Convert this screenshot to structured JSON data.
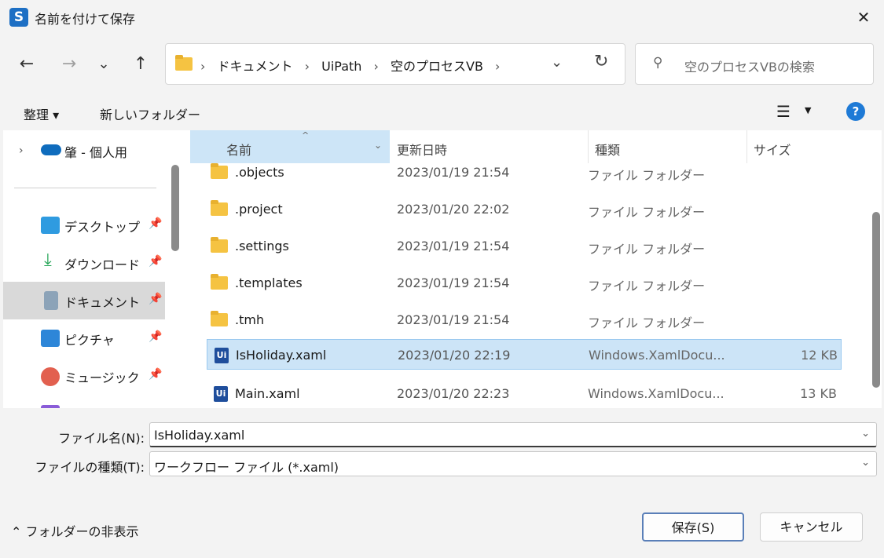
{
  "window": {
    "title": "名前を付けて保存",
    "app_icon": "S",
    "close": "✕"
  },
  "nav": {
    "back": "←",
    "forward": "→",
    "recent": "⌄",
    "up": "↑",
    "breadcrumbs": [
      "ドキュメント",
      "UiPath",
      "空のプロセスVB"
    ],
    "separator": "›",
    "dropdown": "⌄",
    "refresh": "↻",
    "search_placeholder": "空のプロセスVBの検索",
    "search_icon": "⚲"
  },
  "toolbar": {
    "organize": "整理 ▾",
    "new_folder": "新しいフォルダー",
    "view_icon": "☰",
    "view_caret": "▼",
    "help": "?"
  },
  "sidebar": {
    "onedrive": {
      "expand": "›",
      "label": "肇 - 個人用",
      "color": "#0f6cbd"
    },
    "items": [
      {
        "label": "デスクトップ",
        "icon": "desktop-icon",
        "color": "#2f9be0",
        "pin": "📌",
        "selected": false
      },
      {
        "label": "ダウンロード",
        "icon": "download-icon",
        "color": "#23a455",
        "pin": "📌",
        "selected": false
      },
      {
        "label": "ドキュメント",
        "icon": "document-icon",
        "color": "#8ca3b8",
        "pin": "📌",
        "selected": true
      },
      {
        "label": "ピクチャ",
        "icon": "pictures-icon",
        "color": "#2d86d8",
        "pin": "📌",
        "selected": false
      },
      {
        "label": "ミュージック",
        "icon": "music-icon",
        "color": "#e2604f",
        "pin": "📌",
        "selected": false
      }
    ]
  },
  "columns": {
    "name": "名前",
    "date": "更新日時",
    "type": "種類",
    "size": "サイズ",
    "sort_indicator": "^",
    "caret": "⌄"
  },
  "files": [
    {
      "name": ".objects",
      "date": "2023/01/19 21:54",
      "type": "ファイル フォルダー",
      "size": "",
      "kind": "folder",
      "selected": false
    },
    {
      "name": ".project",
      "date": "2023/01/20 22:02",
      "type": "ファイル フォルダー",
      "size": "",
      "kind": "folder",
      "selected": false
    },
    {
      "name": ".settings",
      "date": "2023/01/19 21:54",
      "type": "ファイル フォルダー",
      "size": "",
      "kind": "folder",
      "selected": false
    },
    {
      "name": ".templates",
      "date": "2023/01/19 21:54",
      "type": "ファイル フォルダー",
      "size": "",
      "kind": "folder",
      "selected": false
    },
    {
      "name": ".tmh",
      "date": "2023/01/19 21:54",
      "type": "ファイル フォルダー",
      "size": "",
      "kind": "folder",
      "selected": false
    },
    {
      "name": "IsHoliday.xaml",
      "date": "2023/01/20 22:19",
      "type": "Windows.XamlDocu...",
      "size": "12 KB",
      "kind": "xaml",
      "selected": true
    },
    {
      "name": "Main.xaml",
      "date": "2023/01/20 22:23",
      "type": "Windows.XamlDocu...",
      "size": "13 KB",
      "kind": "xaml",
      "selected": false
    }
  ],
  "xaml_icon_text": "Ui",
  "form": {
    "filename_label": "ファイル名(N):",
    "filename_value": "IsHoliday.xaml",
    "filetype_label": "ファイルの種類(T):",
    "filetype_value": "ワークフロー ファイル  (*.xaml)",
    "caret": "⌄"
  },
  "footer": {
    "hide_folders": "⌃  フォルダーの非表示",
    "save": "保存(S)",
    "cancel": "キャンセル"
  }
}
